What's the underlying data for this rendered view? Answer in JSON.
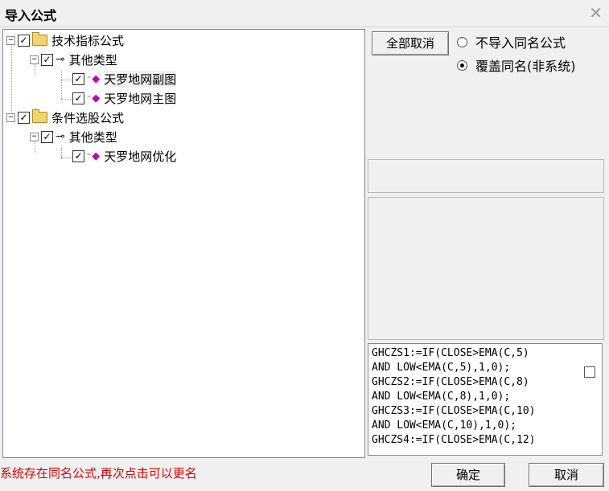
{
  "window": {
    "title": "导入公式",
    "close": "✕"
  },
  "tree": {
    "groups": [
      {
        "label": "技术指标公式",
        "sub": {
          "label": "其他类型",
          "items": [
            "天罗地网副图",
            "天罗地网主图"
          ]
        }
      },
      {
        "label": "条件选股公式",
        "sub": {
          "label": "其他类型",
          "items": [
            "天罗地网优化"
          ]
        }
      }
    ]
  },
  "actions": {
    "deselect_all": "全部取消",
    "ok": "确定",
    "cancel": "取消"
  },
  "options": {
    "skip_same_name": "不导入同名公式",
    "overwrite_same_name": "覆盖同名(非系统)",
    "selected": "overwrite_same_name"
  },
  "code": {
    "lines": [
      "GHCZS1:=IF(CLOSE>EMA(C,5)",
      "AND LOW<EMA(C,5),1,0);",
      "GHCZS2:=IF(CLOSE>EMA(C,8)",
      "AND LOW<EMA(C,8),1,0);",
      "GHCZS3:=IF(CLOSE>EMA(C,10)",
      "AND LOW<EMA(C,10),1,0);",
      "GHCZS4:=IF(CLOSE>EMA(C,12)"
    ]
  },
  "status": {
    "message": "系统存在同名公式,再次点击可以更名"
  }
}
